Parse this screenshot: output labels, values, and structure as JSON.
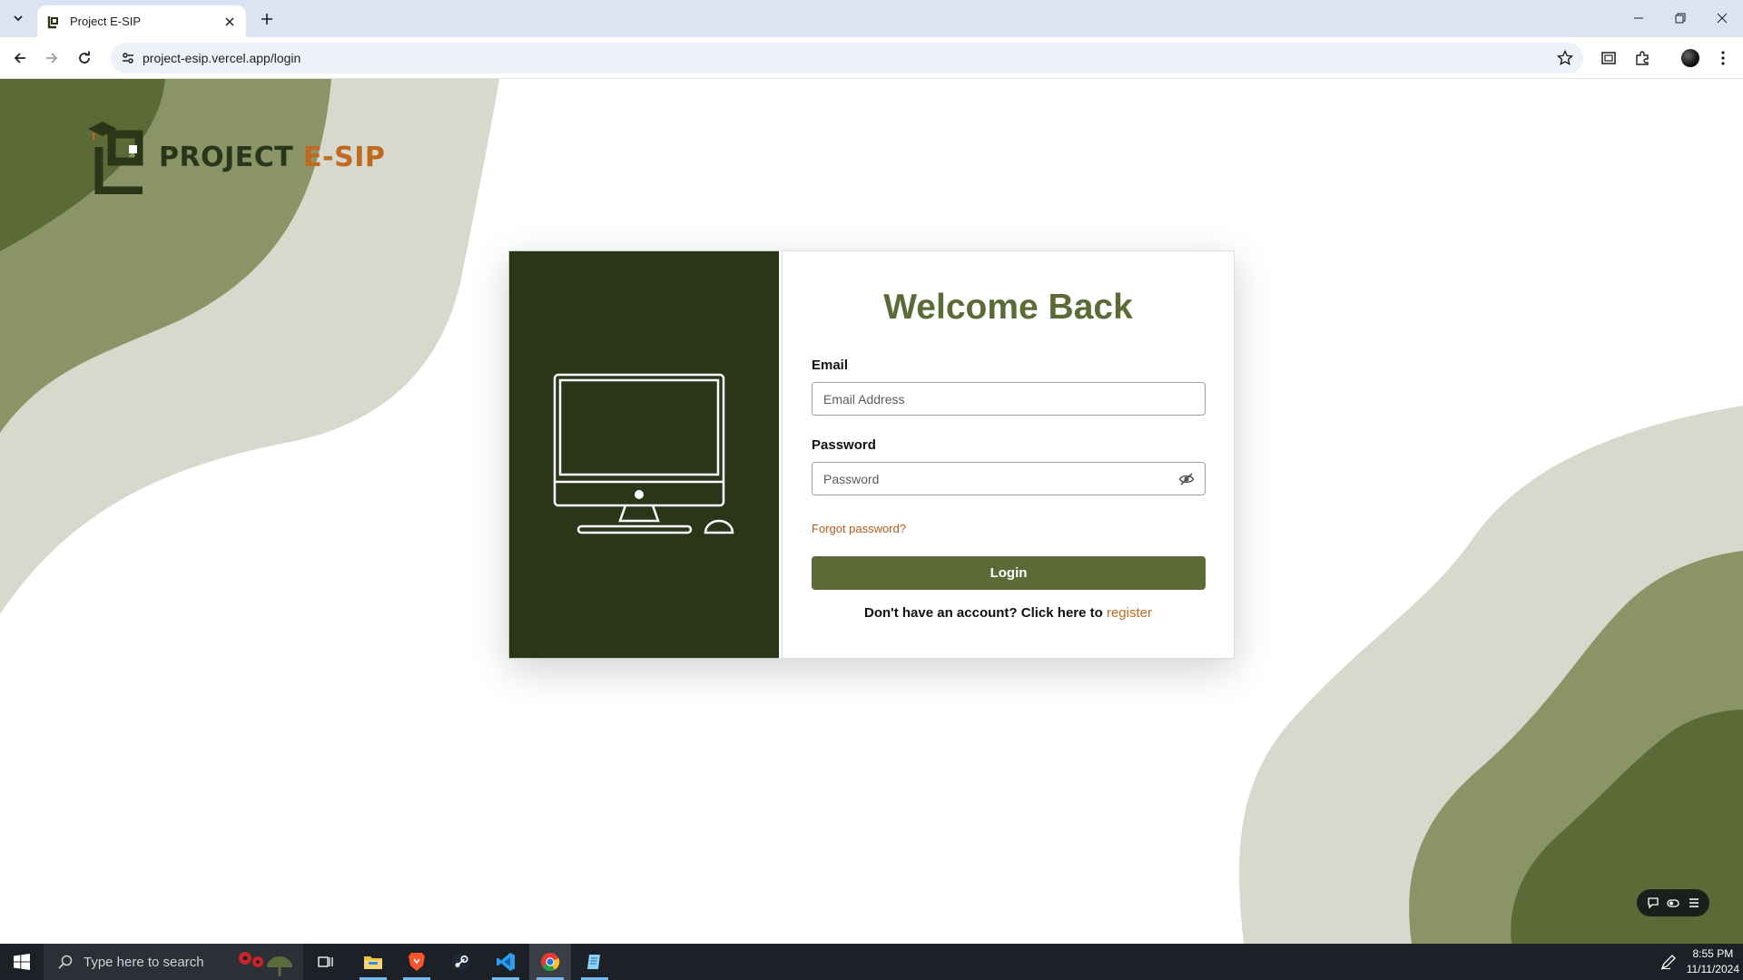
{
  "browser": {
    "tab_title": "Project E-SIP",
    "url": "project-esip.vercel.app/login"
  },
  "logo": {
    "text_part1": "PROJECT ",
    "text_part2": "E-SIP"
  },
  "login": {
    "heading": "Welcome Back",
    "email_label": "Email",
    "email_placeholder": "Email Address",
    "password_label": "Password",
    "password_placeholder": "Password",
    "forgot_link": "Forgot password?",
    "login_button": "Login",
    "register_prompt": "Don't have an account? Click here to ",
    "register_link": "register"
  },
  "taskbar": {
    "search_placeholder": "Type here to search",
    "time": "8:55 PM",
    "date": "11/11/2024"
  },
  "colors": {
    "brand_dark": "#2b3619",
    "brand_olive": "#5b6a37",
    "accent_orange": "#c0691f"
  },
  "icons": [
    "chevron-down-icon",
    "favicon-icon",
    "close-icon",
    "plus-icon",
    "minimize-icon",
    "restore-icon",
    "window-close-icon",
    "back-icon",
    "forward-icon",
    "reload-icon",
    "site-info-icon",
    "star-icon",
    "cast-icon",
    "extensions-icon",
    "profile-icon",
    "more-icon",
    "eye-off-icon",
    "monitor-illustration",
    "windows-icon",
    "search-icon",
    "task-view-icon",
    "file-explorer-icon",
    "brave-icon",
    "steam-icon",
    "vscode-icon",
    "chrome-icon",
    "notepad-icon",
    "pen-icon"
  ]
}
